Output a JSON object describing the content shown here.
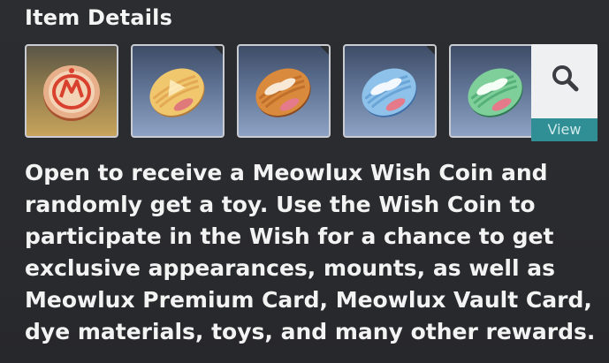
{
  "header": {
    "title": "Item Details"
  },
  "items": [
    {
      "icon": "red-wish-coin-icon",
      "style": "gold"
    },
    {
      "icon": "gold-capsule-coin-icon",
      "style": "blue"
    },
    {
      "icon": "orange-capsule-coin-icon",
      "style": "blue"
    },
    {
      "icon": "blue-capsule-coin-icon",
      "style": "blue"
    },
    {
      "icon": "green-capsule-coin-icon",
      "style": "blue"
    }
  ],
  "view_button": {
    "label": "View",
    "icon": "magnifier-icon"
  },
  "description": {
    "lines": [
      "Open to receive a Meowlux Wish Coin and",
      "randomly get a toy. Use the Wish Coin to",
      "participate in the Wish for a chance to get",
      "exclusive appearances, mounts, as well as",
      "Meowlux Premium Card, Meowlux Vault Card,",
      "dye materials, toys, and many other rewards."
    ]
  },
  "colors": {
    "accent_teal": "#2f8f95",
    "slot_gold": "#c8a45c",
    "slot_blue": "#8da2c4"
  }
}
